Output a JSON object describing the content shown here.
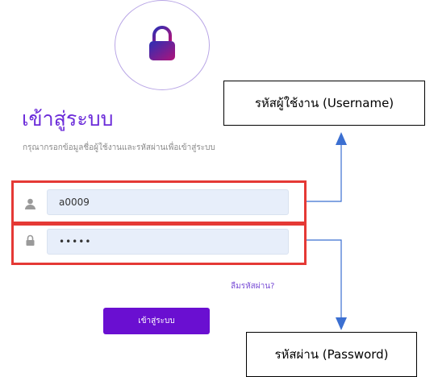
{
  "login": {
    "title": "เข้าสู่ระบบ",
    "subtitle": "กรุณากรอกข้อมูลชื่อผู้ใช้งานและรหัสผ่านเพื่อเข้าสู่ระบบ",
    "username_value": "a0009",
    "password_value": "•••••",
    "forgot_label": "ลืมรหัสผ่าน?",
    "submit_label": "เข้าสู่ระบบ",
    "icons": [
      "lock-icon",
      "user-icon",
      "password-lock-icon"
    ],
    "accent_color": "#6a0fd1"
  },
  "annotations": {
    "username_label": "รหัสผู้ใช้งาน (Username)",
    "password_label": "รหัสผ่าน (Password)",
    "highlight_color": "#e53935",
    "arrow_color": "#3b6fd1"
  }
}
